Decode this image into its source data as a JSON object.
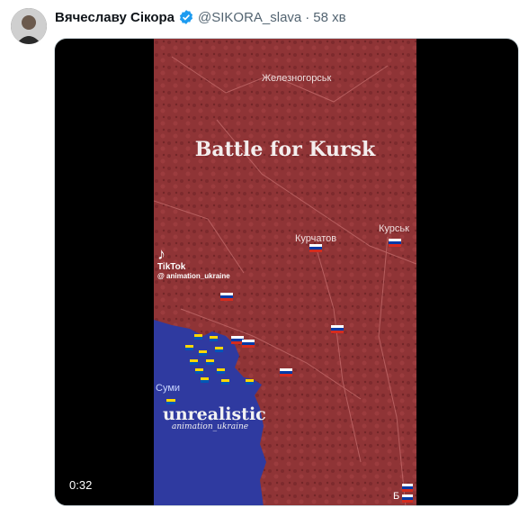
{
  "author": {
    "name": "Вячеславу Сікора",
    "handle": "@SIKORA_slava",
    "separator": "·",
    "time": "58 хв"
  },
  "video": {
    "title": "Battle for Kursk",
    "cities": {
      "zheleznogorsk": "Железногорськ",
      "kurchatov": "Курчатов",
      "kursk": "Курськ",
      "sumy": "Суми",
      "bottom_cut": "Б"
    },
    "watermark_brand": "TikTok",
    "watermark_handle": "@ animation_ukraine",
    "overlay_big": "unrealistic",
    "overlay_small": "animation_ukraine",
    "timestamp": "0:32"
  },
  "colors": {
    "russia_area": "#8f3436",
    "ukraine_area": "#2f3aa0",
    "video_bg": "#000000",
    "verified": "#1d9bf0"
  },
  "icons": [
    "verified-badge-icon",
    "tiktok-logo-icon",
    "russian-flag-icon",
    "ukrainian-flag-icon"
  ]
}
